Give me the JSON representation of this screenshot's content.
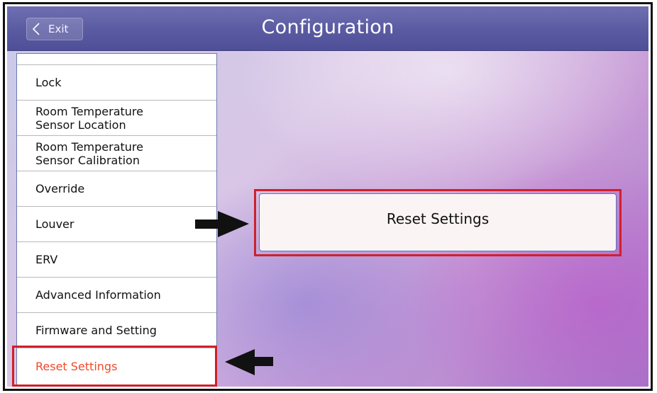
{
  "header": {
    "exit_label": "Exit",
    "title": "Configuration"
  },
  "sidebar": {
    "items": [
      {
        "label": "Lock",
        "active": false
      },
      {
        "label": "Room Temperature\nSensor Location",
        "active": false
      },
      {
        "label": "Room Temperature\nSensor Calibration",
        "active": false
      },
      {
        "label": "Override",
        "active": false
      },
      {
        "label": "Louver",
        "active": false
      },
      {
        "label": "ERV",
        "active": false
      },
      {
        "label": "Advanced Information",
        "active": false
      },
      {
        "label": "Firmware and Setting",
        "active": false
      },
      {
        "label": "Reset Settings",
        "active": true
      }
    ]
  },
  "main": {
    "reset_button_label": "Reset Settings"
  },
  "annotations": {
    "highlight_color": "#d0202a",
    "active_item_color": "#f04a2a",
    "icons": [
      "chevron-left-icon",
      "arrow-right-icon",
      "arrow-left-icon"
    ]
  }
}
